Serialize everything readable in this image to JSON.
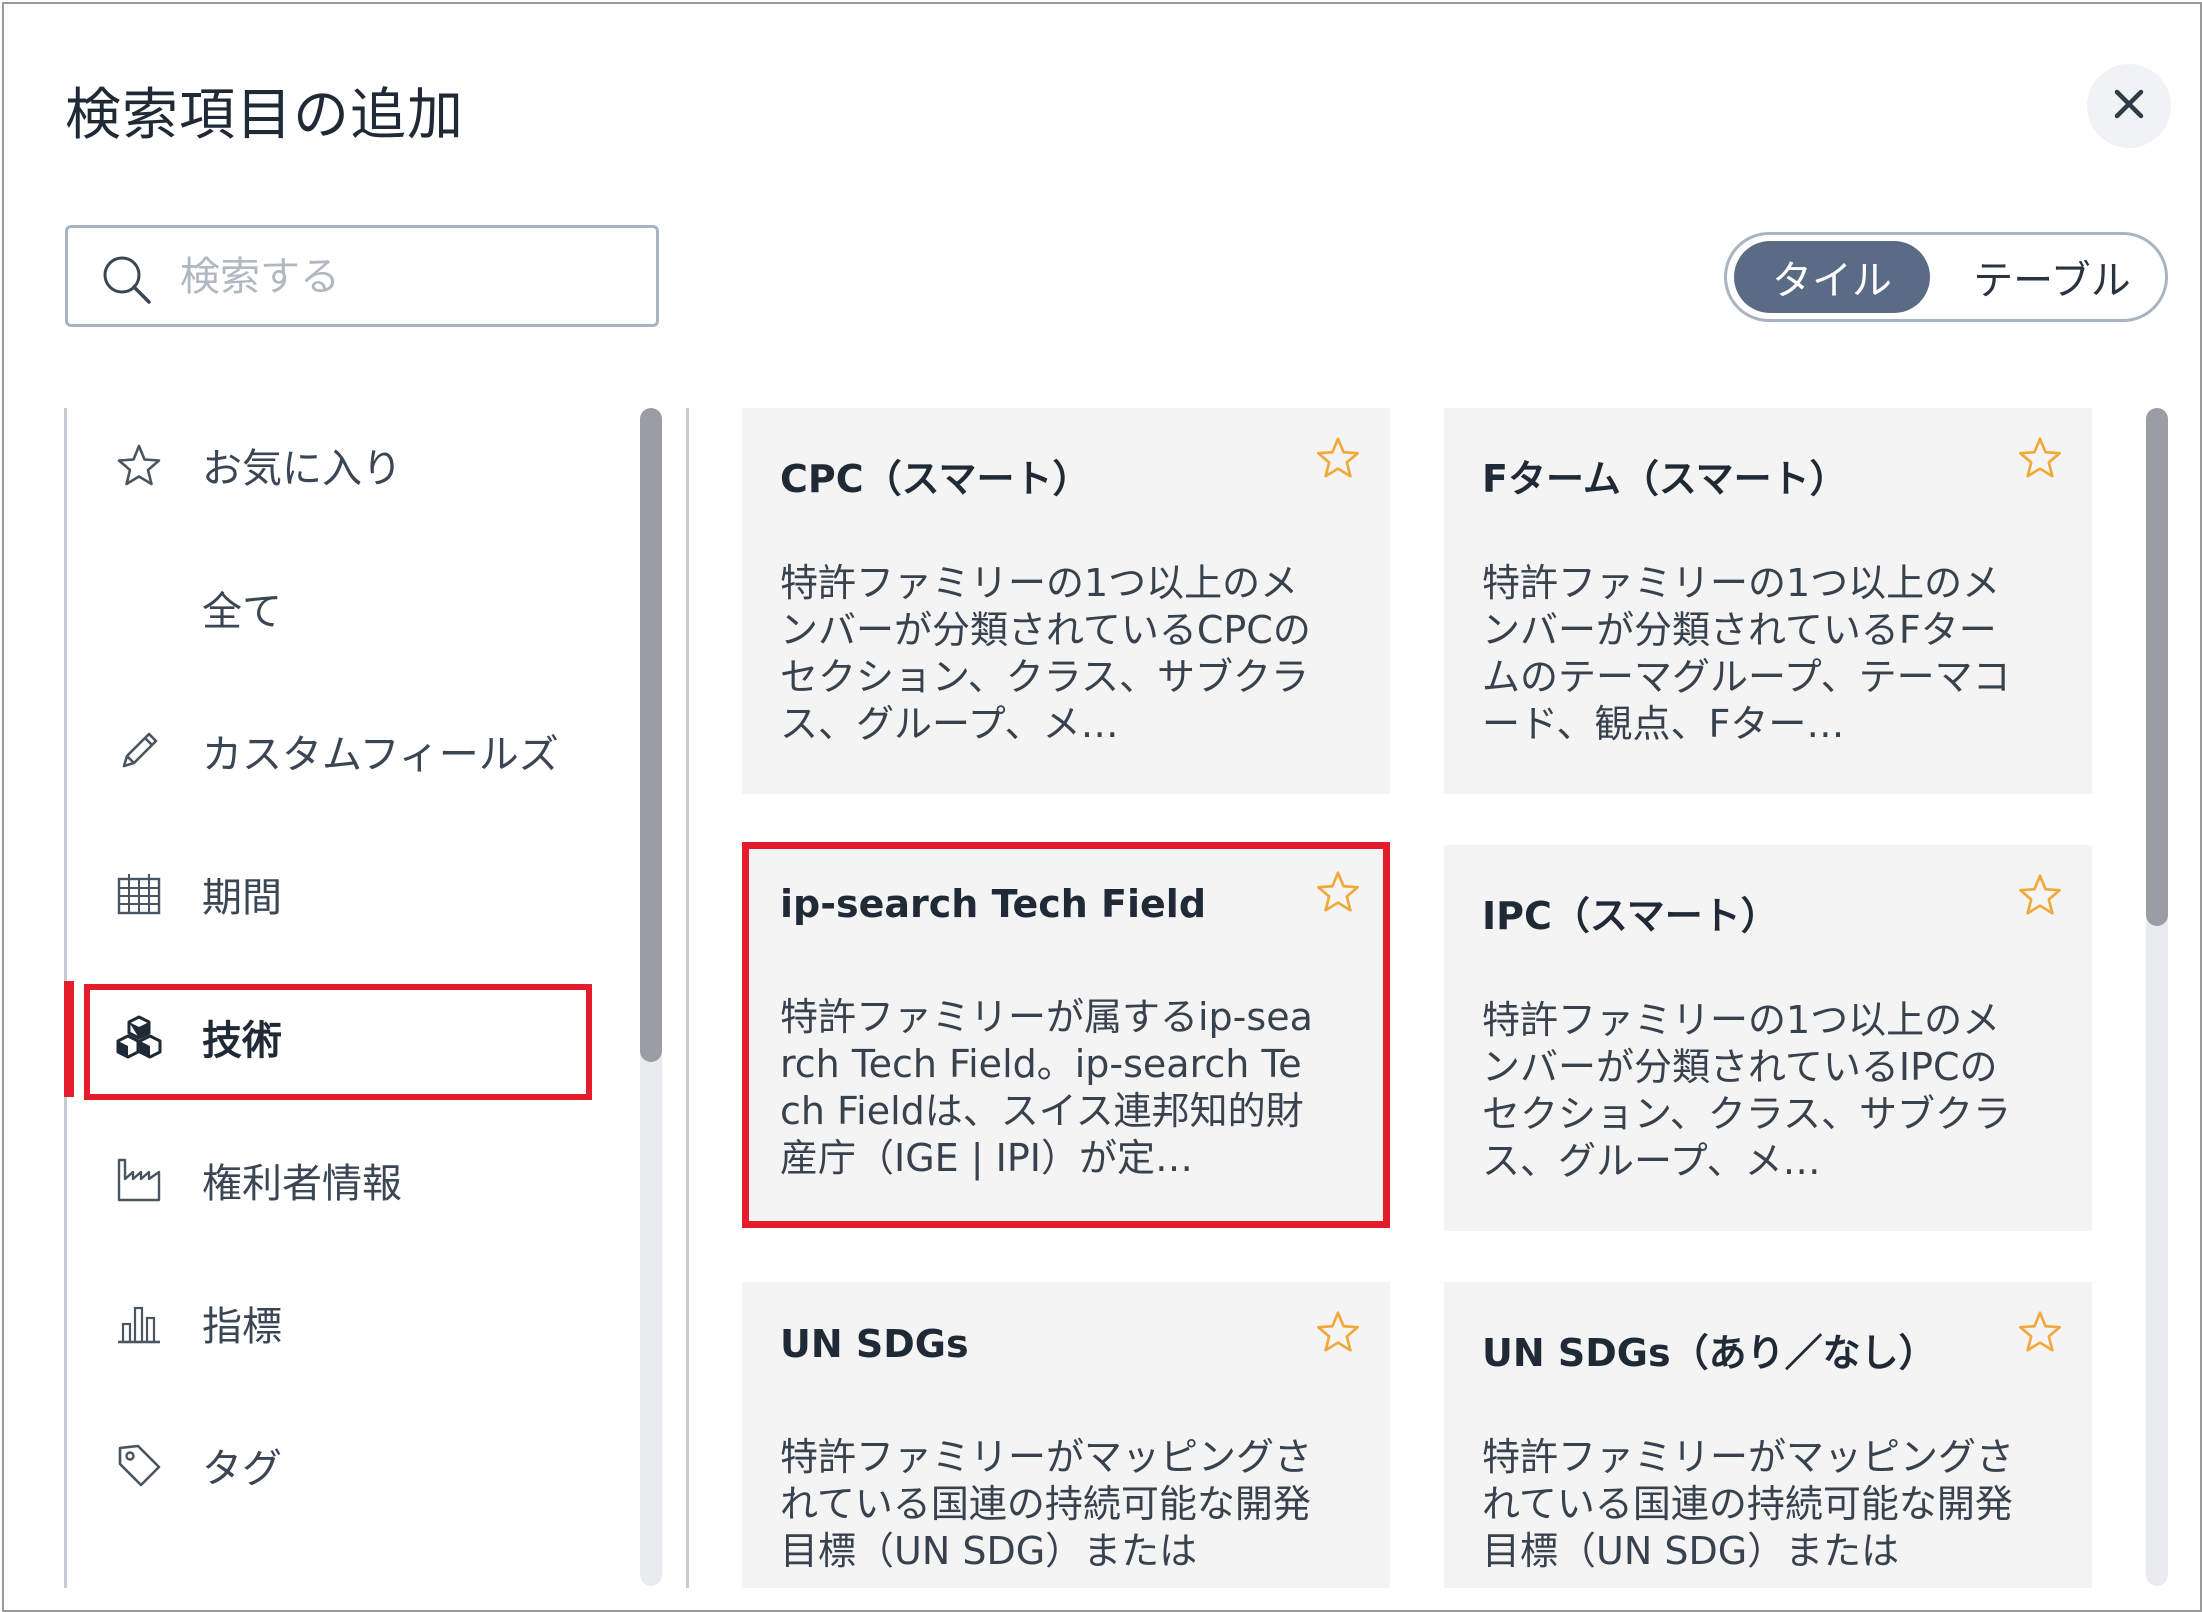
{
  "dialog": {
    "title": "検索項目の追加"
  },
  "search": {
    "placeholder": "検索する",
    "value": ""
  },
  "view_toggle": {
    "options": [
      "タイル",
      "テーブル"
    ],
    "selected": "タイル"
  },
  "sidebar": {
    "active": "技術",
    "items": [
      {
        "label": "お気に入り",
        "icon": "star-icon"
      },
      {
        "label": "全て",
        "icon": ""
      },
      {
        "label": "カスタムフィールズ",
        "icon": "pencil-icon"
      },
      {
        "label": "期間",
        "icon": "calendar-icon"
      },
      {
        "label": "技術",
        "icon": "cubes-icon"
      },
      {
        "label": "権利者情報",
        "icon": "factory-icon"
      },
      {
        "label": "指標",
        "icon": "bar-chart-icon"
      },
      {
        "label": "タグ",
        "icon": "tag-icon"
      }
    ]
  },
  "cards": [
    {
      "title": "CPC（スマート）",
      "description": "特許ファミリーの1つ以上のメンバーが分類されているCPCのセクション、クラス、サブクラス、グループ、メ…"
    },
    {
      "title": "Fターム（スマート）",
      "description": "特許ファミリーの1つ以上のメンバーが分類されているFタームのテーマグループ、テーマコード、観点、Fター…"
    },
    {
      "title": "ip-search Tech Field",
      "description": "特許ファミリーが属するip-search Tech Field。ip-search Tech Fieldは、スイス連邦知的財産庁（IGE | IPI）が定…"
    },
    {
      "title": "IPC（スマート）",
      "description": "特許ファミリーの1つ以上のメンバーが分類されているIPCのセクション、クラス、サブクラス、グループ、メ…"
    },
    {
      "title": "UN SDGs",
      "description": "特許ファミリーがマッピングされている国連の持続可能な開発目標（UN SDG）または"
    },
    {
      "title": "UN SDGs（あり／なし）",
      "description": "特許ファミリーがマッピングされている国連の持続可能な開発目標（UN SDG）または"
    }
  ],
  "colors": {
    "highlight": "#e31e2a",
    "toggle_active": "#5a6b85",
    "star": "#f2a93b",
    "card_bg": "#f4f4f4"
  }
}
